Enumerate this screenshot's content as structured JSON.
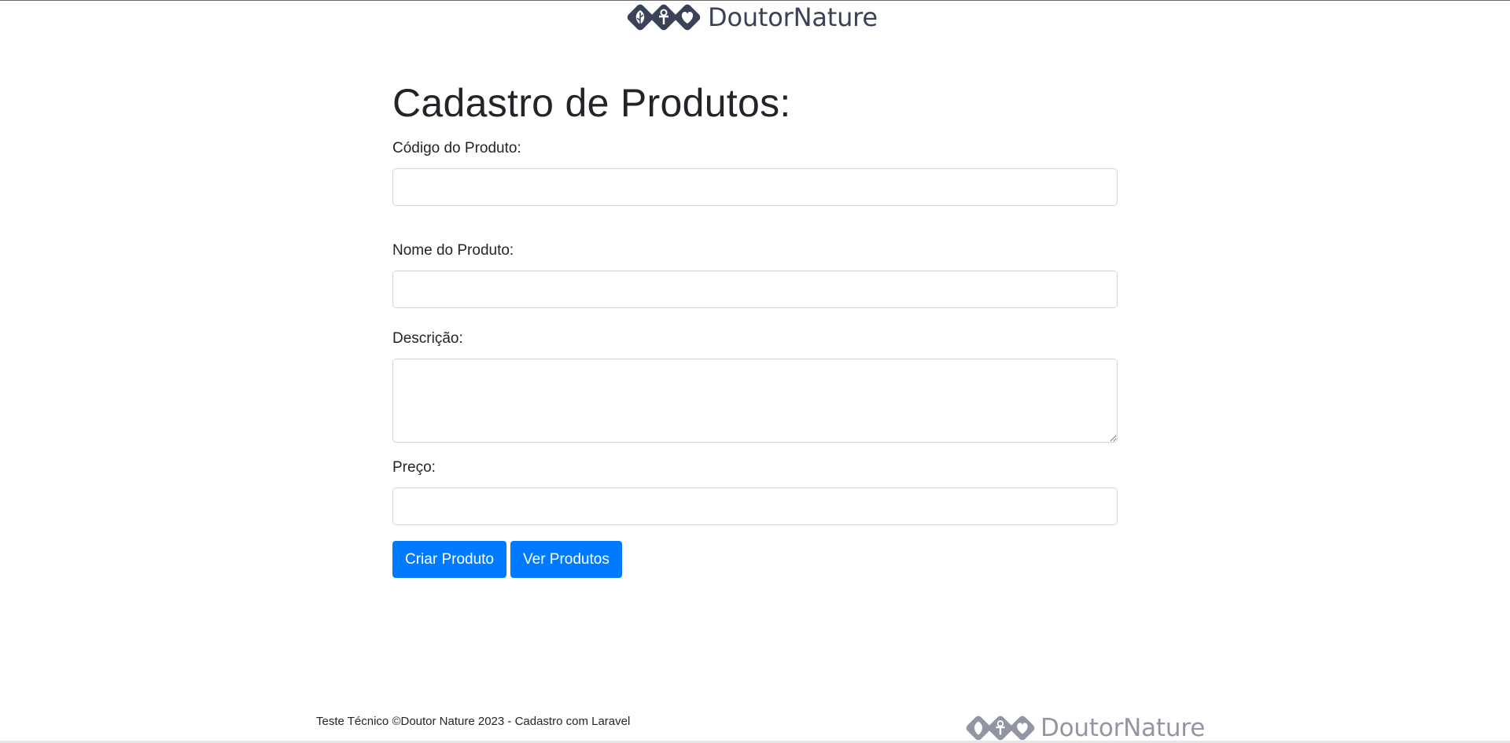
{
  "brand": {
    "name": "DoutorNature",
    "color": "#3a4257",
    "icons": [
      "leaf-icon",
      "person-icon",
      "heart-icon"
    ]
  },
  "form": {
    "title": "Cadastro de Produtos:",
    "fields": [
      {
        "label": "Código do Produto:",
        "value": "",
        "placeholder": ""
      },
      {
        "label": "Nome do Produto:",
        "value": "",
        "placeholder": ""
      },
      {
        "label": "Descrição:",
        "value": "",
        "placeholder": ""
      },
      {
        "label": "Preço:",
        "value": "",
        "placeholder": ""
      }
    ],
    "buttons": {
      "create": "Criar Produto",
      "view": "Ver Produtos",
      "color": "#007bff"
    }
  },
  "footer": {
    "text": "Teste Técnico ©Doutor Nature 2023 - Cadastro com Laravel"
  }
}
